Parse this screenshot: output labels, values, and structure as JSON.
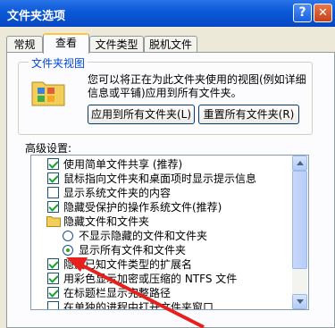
{
  "window": {
    "title": "文件夹选项"
  },
  "titlebar": {
    "help_label": "?",
    "close_label": "✕"
  },
  "tabs": [
    {
      "label": "常规",
      "active": false
    },
    {
      "label": "查看",
      "active": true
    },
    {
      "label": "文件类型",
      "active": false
    },
    {
      "label": "脱机文件",
      "active": false
    }
  ],
  "folder_view": {
    "group_label": "文件夹视图",
    "description": "您可以将正在为此文件夹使用的视图(例如详细信息或平铺)应用到所有文件夹。",
    "apply_all_label": "应用到所有文件夹(L)",
    "reset_all_label": "重置所有文件夹(R)"
  },
  "advanced": {
    "label": "高级设置:",
    "items": [
      {
        "text": "使用简单文件共享 (推荐)",
        "type": "checkbox",
        "checked": true,
        "level": 0
      },
      {
        "text": "鼠标指向文件夹和桌面项时显示提示信息",
        "type": "checkbox",
        "checked": true,
        "level": 0
      },
      {
        "text": "显示系统文件夹的内容",
        "type": "checkbox",
        "checked": false,
        "level": 0
      },
      {
        "text": "隐藏受保护的操作系统文件(推荐)",
        "type": "checkbox",
        "checked": true,
        "level": 0
      },
      {
        "text": "隐藏文件和文件夹",
        "type": "folder",
        "checked": false,
        "level": 0
      },
      {
        "text": "不显示隐藏的文件和文件夹",
        "type": "radio",
        "checked": false,
        "level": 1
      },
      {
        "text": "显示所有文件和文件夹",
        "type": "radio",
        "checked": true,
        "level": 1
      },
      {
        "text": "隐藏已知文件类型的扩展名",
        "type": "checkbox",
        "checked": true,
        "level": 0
      },
      {
        "text": "用彩色显示加密或压缩的 NTFS 文件",
        "type": "checkbox",
        "checked": true,
        "level": 0
      },
      {
        "text": "在标题栏显示完整路径",
        "type": "checkbox",
        "checked": true,
        "level": 0
      },
      {
        "text": "在单独的进程中打开文件夹窗口",
        "type": "checkbox",
        "checked": false,
        "level": 0
      }
    ]
  },
  "colors": {
    "accent": "#0a58d8",
    "annotation_arrow": "#e8201c"
  }
}
